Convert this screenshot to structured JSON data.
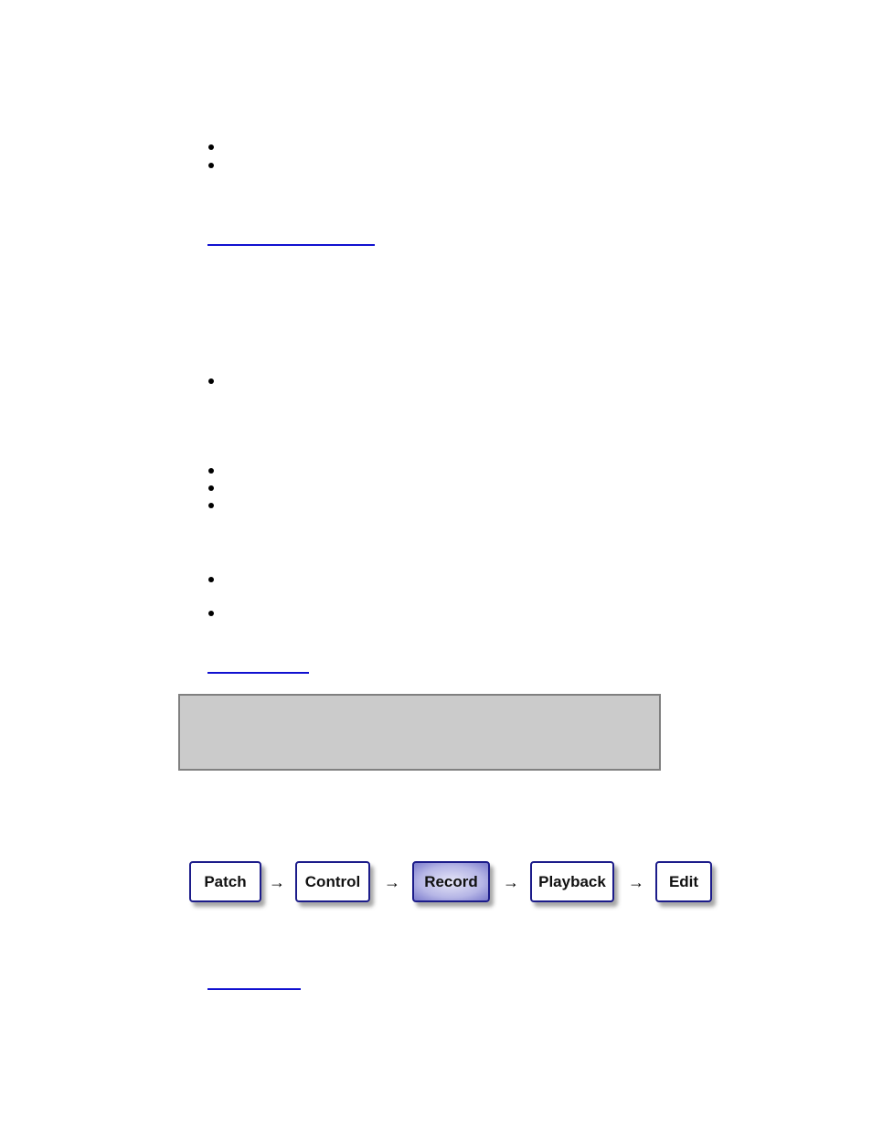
{
  "document": {
    "bullet_groups": [
      {
        "count": 2
      },
      {
        "count": 1
      },
      {
        "count": 3
      },
      {
        "count": 2
      }
    ],
    "links": [
      {
        "text": ""
      },
      {
        "text": ""
      },
      {
        "text": ""
      }
    ],
    "note_box": {
      "text": ""
    }
  },
  "workflow": {
    "steps": [
      {
        "label": "Patch",
        "active": false
      },
      {
        "label": "Control",
        "active": false
      },
      {
        "label": "Record",
        "active": true
      },
      {
        "label": "Playback",
        "active": false
      },
      {
        "label": "Edit",
        "active": false
      }
    ],
    "arrow_glyph": "→",
    "colors": {
      "border": "#1c1c8a",
      "active_fill": "#b6b6e6",
      "link": "#1010d0",
      "note_bg": "#cbcbcb"
    }
  }
}
